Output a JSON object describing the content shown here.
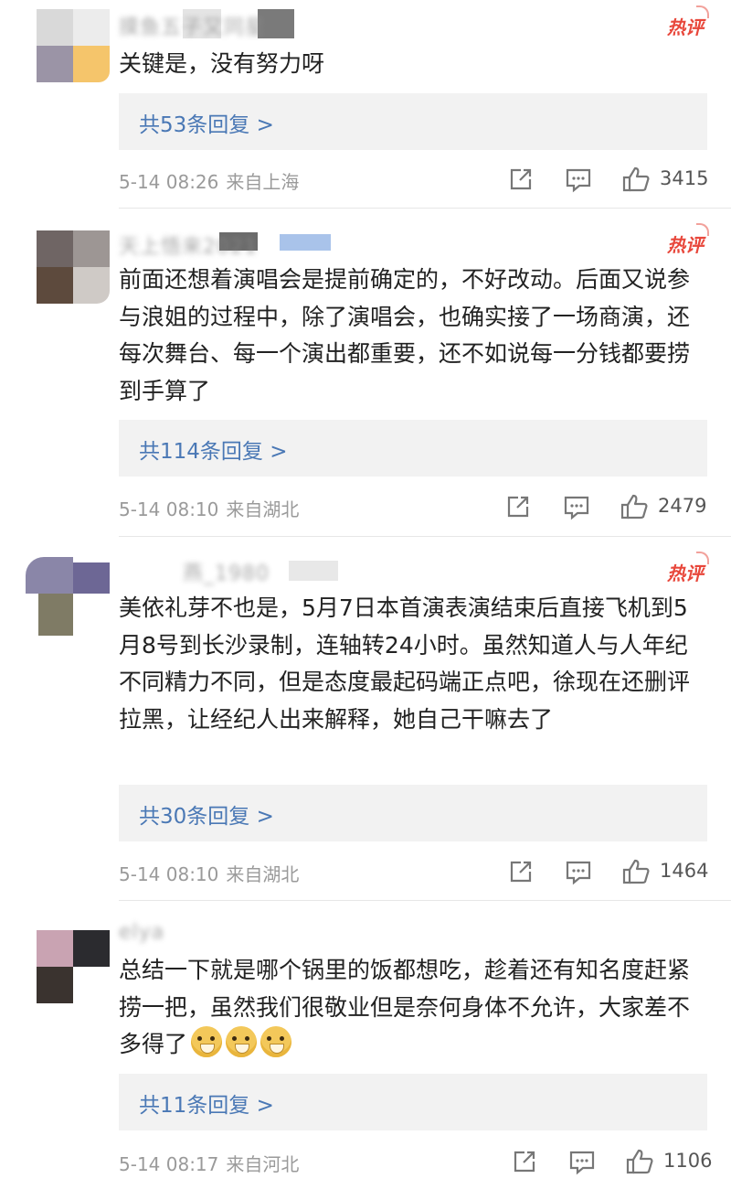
{
  "comments": [
    {
      "username": "摸鱼五子又同星",
      "badge": "热评",
      "text": "关键是，没有努力呀",
      "reply_label": "共53条回复 >",
      "date": "5-14 08:26",
      "location": "来自上海",
      "likes": "3415",
      "avatar_colors": [
        "#d9d9d9",
        "#ececec",
        "#9b94a6",
        "#f5c56b"
      ]
    },
    {
      "username": "天上悟来2021",
      "badge": "热评",
      "text": "前面还想着演唱会是提前确定的，不好改动。后面又说参与浪姐的过程中，除了演唱会，也确实接了一场商演，还每次舞台、每一个演出都重要，还不如说每一分钱都要捞到手算了",
      "reply_label": "共114条回复 >",
      "date": "5-14 08:10",
      "location": "来自湖北",
      "likes": "2479",
      "avatar_colors": [
        "#6f6564",
        "#9d9694",
        "#5d4a3d",
        "#cfcac6"
      ]
    },
    {
      "username": "燕_1980",
      "badge": "热评",
      "text": "美依礼芽不也是，5月7日本首演表演结束后直接飞机到5月8号到长沙录制，连轴转24小时。虽然知道人与人年纪不同精力不同，但是态度最起码端正点吧，徐现在还删评拉黑，让经纪人出来解释，她自己干嘛去了",
      "reply_label": "共30条回复 >",
      "date": "5-14 08:10",
      "location": "来自湖北",
      "likes": "1464",
      "avatar_colors": [
        "#8a86a8",
        "#6d6795",
        "#7f7b65",
        "#ffffff"
      ]
    },
    {
      "username": "elya",
      "badge": "热评",
      "text": "总结一下就是哪个锅里的饭都想吃，趁着还有知名度赶紧捞一把，虽然我们很敬业但是奈何身体不允许，大家差不多得了",
      "reply_label": "共11条回复 >",
      "date": "5-14 08:17",
      "location": "来自河北",
      "likes": "1106",
      "avatar_colors": [
        "#c9a3b2",
        "#2b2b2f",
        "#3a332f",
        "#ffffff"
      ]
    }
  ],
  "icons": {
    "share": "share-icon",
    "comment": "comment-icon",
    "like": "like-icon",
    "emoji": "doge-emoji"
  }
}
